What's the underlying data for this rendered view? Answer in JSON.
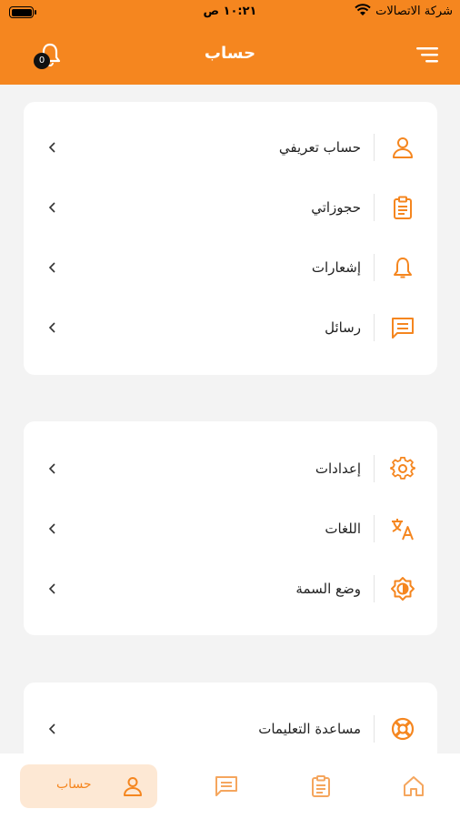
{
  "status_bar": {
    "carrier": "شركة الاتصالات",
    "time": "١٠:٢١ ص"
  },
  "header": {
    "title": "حساب",
    "notification_count": "0"
  },
  "colors": {
    "accent": "#f5861f",
    "accent_light": "#fde8d4",
    "card_bg": "#ffffff",
    "page_bg": "#f3f3f3"
  },
  "menu": {
    "group1": [
      {
        "label": "حساب تعريفي",
        "icon": "user-icon"
      },
      {
        "label": "حجوزاتي",
        "icon": "clipboard-icon"
      },
      {
        "label": "إشعارات",
        "icon": "bell-icon"
      },
      {
        "label": "رسائل",
        "icon": "message-icon"
      }
    ],
    "group2": [
      {
        "label": "إعدادات",
        "icon": "gear-icon"
      },
      {
        "label": "اللغات",
        "icon": "translate-icon"
      },
      {
        "label": "وضع السمة",
        "icon": "theme-mode-icon"
      }
    ],
    "group3": [
      {
        "label": "مساعدة التعليمات",
        "icon": "lifebuoy-icon"
      }
    ]
  },
  "bottom_nav": {
    "account_label": "حساب",
    "items": [
      "account-icon",
      "messages-icon",
      "bookings-icon",
      "home-icon"
    ]
  }
}
